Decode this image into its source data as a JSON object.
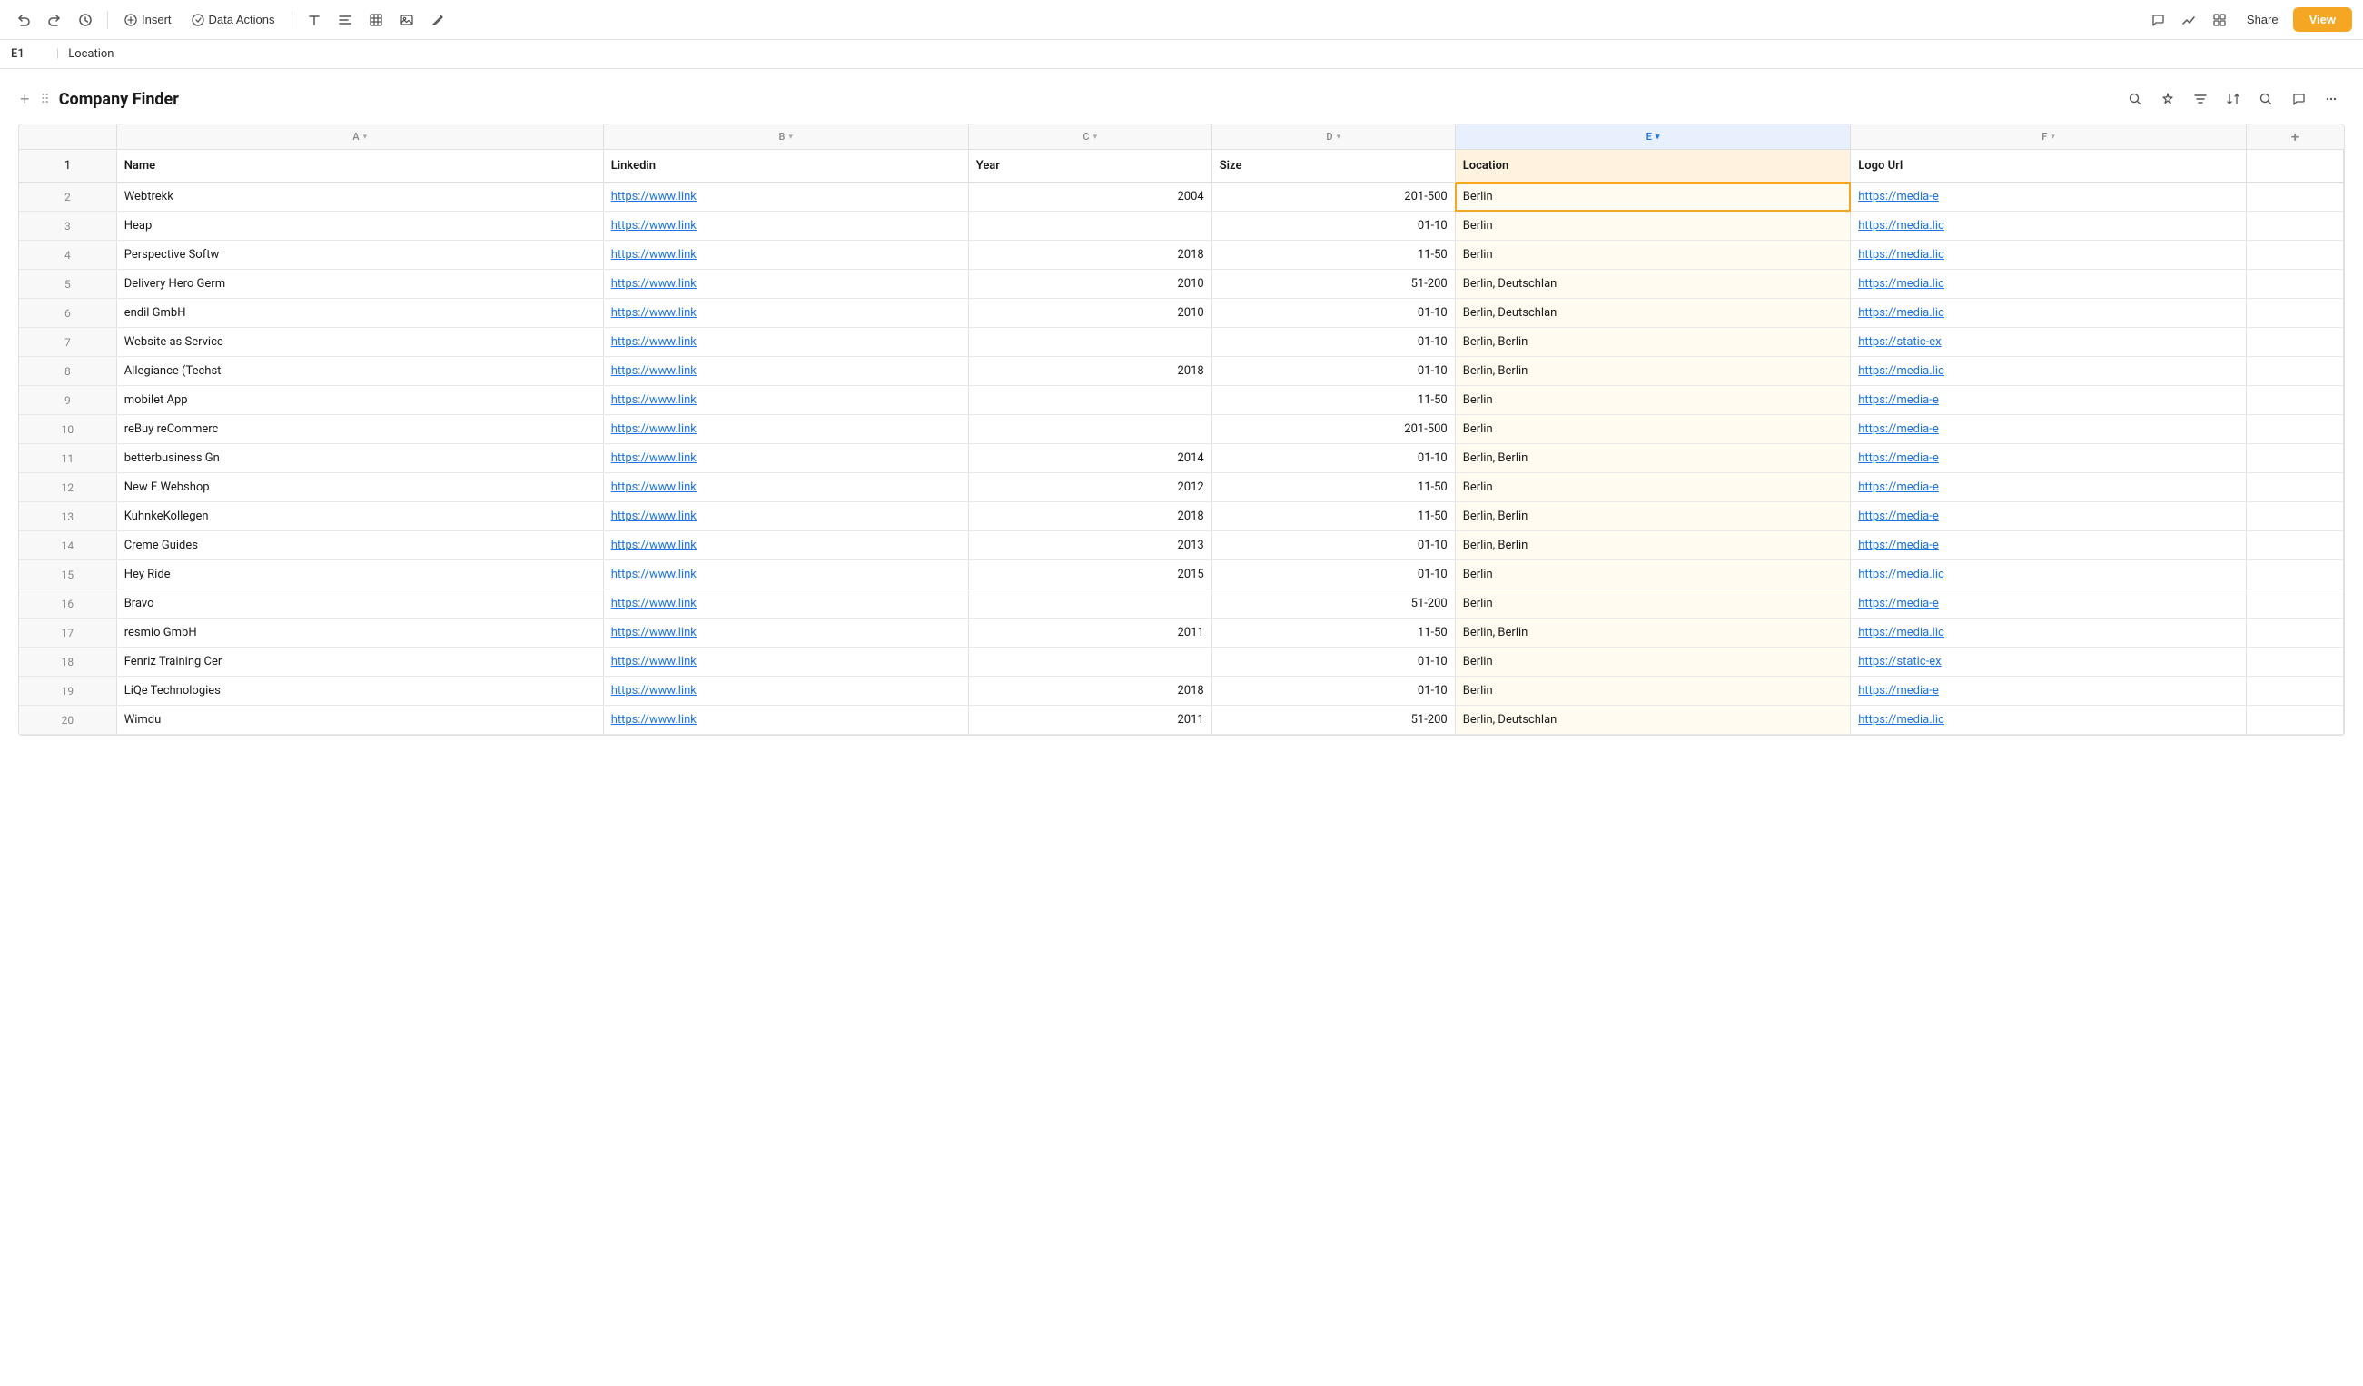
{
  "toolbar": {
    "undo_icon": "↩",
    "redo_icon": "↪",
    "history_icon": "🕐",
    "insert_label": "Insert",
    "data_actions_label": "Data Actions",
    "text_icon": "T",
    "align_icon": "≡",
    "table_icon": "⊞",
    "image_icon": "⬜",
    "draw_icon": "✏",
    "share_label": "Share",
    "view_label": "View"
  },
  "cell_ref": {
    "id": "E1",
    "value": "Location"
  },
  "widget": {
    "title": "Company Finder",
    "search_icon": "🔍",
    "sparkle_icon": "✦",
    "filter_icon": "⚡",
    "sort_icon": "↕",
    "find_icon": "🔍",
    "comment_icon": "💬",
    "more_icon": "⋯"
  },
  "columns": {
    "row_num_header": "",
    "A": {
      "label": "A",
      "header": "Name"
    },
    "B": {
      "label": "B",
      "header": "Linkedin"
    },
    "C": {
      "label": "C",
      "header": "Year"
    },
    "D": {
      "label": "D",
      "header": "Size"
    },
    "E": {
      "label": "E",
      "header": "Location",
      "active": true
    },
    "F": {
      "label": "F",
      "header": "Logo Url"
    }
  },
  "rows": [
    {
      "num": 2,
      "name": "Webtrekk",
      "linkedin": "https://www.link",
      "year": "2004",
      "size": "201-500",
      "location": "Berlin",
      "logo": "https://media-e"
    },
    {
      "num": 3,
      "name": "Heap",
      "linkedin": "https://www.link",
      "year": "",
      "size": "01-10",
      "location": "Berlin",
      "logo": "https://media.lic"
    },
    {
      "num": 4,
      "name": "Perspective Softw",
      "linkedin": "https://www.link",
      "year": "2018",
      "size": "11-50",
      "location": "Berlin",
      "logo": "https://media.lic"
    },
    {
      "num": 5,
      "name": "Delivery Hero Germ",
      "linkedin": "https://www.link",
      "year": "2010",
      "size": "51-200",
      "location": "Berlin, Deutschlan",
      "logo": "https://media.lic"
    },
    {
      "num": 6,
      "name": "endil GmbH",
      "linkedin": "https://www.link",
      "year": "2010",
      "size": "01-10",
      "location": "Berlin, Deutschlan",
      "logo": "https://media.lic"
    },
    {
      "num": 7,
      "name": "Website as Service",
      "linkedin": "https://www.link",
      "year": "",
      "size": "01-10",
      "location": "Berlin, Berlin",
      "logo": "https://static-ex"
    },
    {
      "num": 8,
      "name": "Allegiance (Techst",
      "linkedin": "https://www.link",
      "year": "2018",
      "size": "01-10",
      "location": "Berlin, Berlin",
      "logo": "https://media.lic"
    },
    {
      "num": 9,
      "name": "mobilet App",
      "linkedin": "https://www.link",
      "year": "",
      "size": "11-50",
      "location": "Berlin",
      "logo": "https://media-e"
    },
    {
      "num": 10,
      "name": "reBuy reCommerc",
      "linkedin": "https://www.link",
      "year": "",
      "size": "201-500",
      "location": "Berlin",
      "logo": "https://media-e"
    },
    {
      "num": 11,
      "name": "betterbusiness Gn",
      "linkedin": "https://www.link",
      "year": "2014",
      "size": "01-10",
      "location": "Berlin, Berlin",
      "logo": "https://media-e"
    },
    {
      "num": 12,
      "name": "New E Webshop",
      "linkedin": "https://www.link",
      "year": "2012",
      "size": "11-50",
      "location": "Berlin",
      "logo": "https://media-e"
    },
    {
      "num": 13,
      "name": "KuhnkeKollegen",
      "linkedin": "https://www.link",
      "year": "2018",
      "size": "11-50",
      "location": "Berlin, Berlin",
      "logo": "https://media-e"
    },
    {
      "num": 14,
      "name": "Creme Guides",
      "linkedin": "https://www.link",
      "year": "2013",
      "size": "01-10",
      "location": "Berlin, Berlin",
      "logo": "https://media-e"
    },
    {
      "num": 15,
      "name": "Hey Ride",
      "linkedin": "https://www.link",
      "year": "2015",
      "size": "01-10",
      "location": "Berlin",
      "logo": "https://media.lic"
    },
    {
      "num": 16,
      "name": "Bravo",
      "linkedin": "https://www.link",
      "year": "",
      "size": "51-200",
      "location": "Berlin",
      "logo": "https://media-e"
    },
    {
      "num": 17,
      "name": "resmio GmbH",
      "linkedin": "https://www.link",
      "year": "2011",
      "size": "11-50",
      "location": "Berlin, Berlin",
      "logo": "https://media.lic"
    },
    {
      "num": 18,
      "name": "Fenriz Training Cer",
      "linkedin": "https://www.link",
      "year": "",
      "size": "01-10",
      "location": "Berlin",
      "logo": "https://static-ex"
    },
    {
      "num": 19,
      "name": "LiQe Technologies",
      "linkedin": "https://www.link",
      "year": "2018",
      "size": "01-10",
      "location": "Berlin",
      "logo": "https://media-e"
    },
    {
      "num": 20,
      "name": "Wimdu",
      "linkedin": "https://www.link",
      "year": "2011",
      "size": "51-200",
      "location": "Berlin, Deutschlan",
      "logo": "https://media.lic"
    }
  ]
}
